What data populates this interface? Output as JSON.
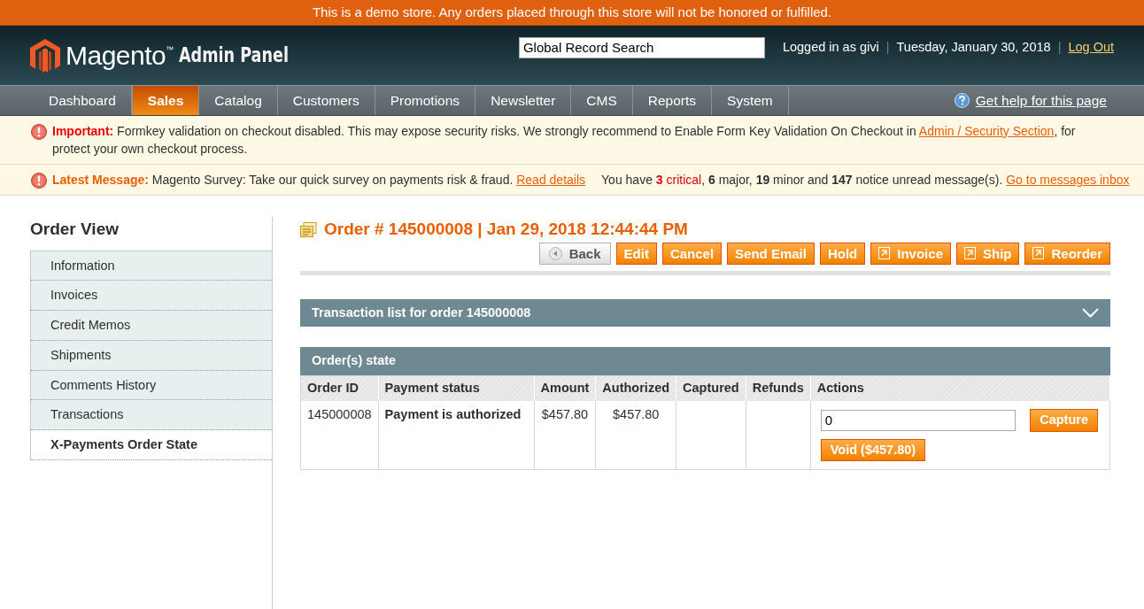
{
  "demo_notice": "This is a demo store. Any orders placed through this store will not be honored or fulfilled.",
  "header": {
    "logo_brand": "Magento$^{™}$",
    "logo_product": "Admin Panel",
    "search": {
      "value": "Global Record Search"
    },
    "status": [
      {
        "kind": "text",
        "text": "Logged in as givi"
      },
      {
        "kind": "separator",
        "text": "|"
      },
      {
        "kind": "text",
        "text": "Tuesday, January 30, 2018"
      },
      {
        "kind": "separator",
        "text": "|"
      },
      {
        "kind": "link",
        "text": "Log Out"
      }
    ]
  },
  "nav": {
    "items": [
      {
        "label": "Dashboard",
        "selected": false
      },
      {
        "label": "Sales",
        "selected": true
      },
      {
        "label": "Catalog",
        "selected": false
      },
      {
        "label": "Customers",
        "selected": false
      },
      {
        "label": "Promotions",
        "selected": false
      },
      {
        "label": "Newsletter",
        "selected": false
      },
      {
        "label": "CMS",
        "selected": false
      },
      {
        "label": "Reports",
        "selected": false
      },
      {
        "label": "System",
        "selected": false
      }
    ],
    "help": "Get help for this page"
  },
  "messages": [
    {
      "kind": "important",
      "label": "Important:",
      "text": "Formkey validation on checkout disabled. This may expose security risks. We strongly recommend to Enable Form Key Validation On Checkout in",
      "link": "Admin / Security Section",
      "text_after": ", for protect your own checkout process."
    },
    {
      "kind": "latest",
      "label": "Latest Message:",
      "text": "Magento Survey: Take our quick survey on payments risk & fraud.",
      "link": "Read details",
      "summary": {
        "prefix": "You have",
        "critical_count": "3",
        "critical_label": "critical",
        "rest": ", **6** major, **19** minor and **147** notice unread message(s)."
      },
      "inbox_link": "Go to messages inbox"
    }
  ],
  "sidebar": {
    "title": "Order View",
    "items": [
      {
        "label": "Information",
        "selected": false
      },
      {
        "label": "Invoices",
        "selected": false
      },
      {
        "label": "Credit Memos",
        "selected": false
      },
      {
        "label": "Shipments",
        "selected": false
      },
      {
        "label": "Comments History",
        "selected": false
      },
      {
        "label": "Transactions",
        "selected": false
      },
      {
        "label": "X-Payments Order State",
        "selected": true
      }
    ]
  },
  "order": {
    "title": "Order # 145000008 | Jan 29, 2018 12:44:44 PM",
    "buttons": [
      {
        "kind": "back",
        "label": "Back"
      },
      {
        "kind": "plain",
        "label": "Edit"
      },
      {
        "kind": "plain",
        "label": "Cancel"
      },
      {
        "kind": "plain",
        "label": "Send Email"
      },
      {
        "kind": "plain",
        "label": "Hold"
      },
      {
        "kind": "icon",
        "label": "Invoice"
      },
      {
        "kind": "icon",
        "label": "Ship"
      },
      {
        "kind": "icon",
        "label": "Reorder"
      }
    ]
  },
  "transactions_section": {
    "title": "Transaction list for order 145000008",
    "expanded": false
  },
  "order_state": {
    "title": "Order(s) state",
    "columns": [
      "Order ID",
      "Payment status",
      "Amount",
      "Authorized",
      "Captured",
      "Refunds",
      "Actions"
    ],
    "rows": [
      {
        "order_id": "145000008",
        "payment_status": "Payment is authorized",
        "amount": "$457.80",
        "authorized": "$457.80",
        "captured": "",
        "refunds": "",
        "capture_amount": "0",
        "capture_button": "Capture",
        "void_button": "Void ($457.80)"
      }
    ]
  }
}
